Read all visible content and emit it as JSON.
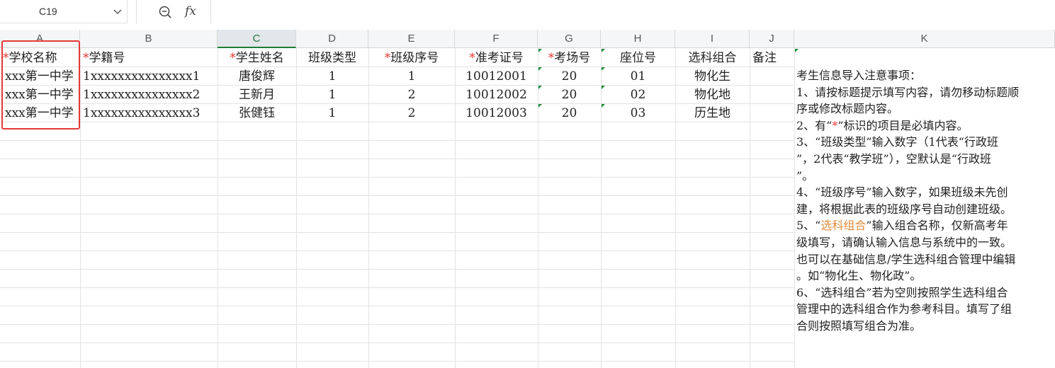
{
  "name_box": {
    "ref": "C19"
  },
  "formula_bar": {
    "fx_label": "fx",
    "content": ""
  },
  "columns": [
    "A",
    "B",
    "C",
    "D",
    "E",
    "F",
    "G",
    "H",
    "I",
    "J",
    "K"
  ],
  "headers": [
    {
      "col": "A",
      "star": "*",
      "label": "学校名称"
    },
    {
      "col": "B",
      "star": "*",
      "label": "学籍号"
    },
    {
      "col": "C",
      "star": "*",
      "label": "学生姓名"
    },
    {
      "col": "D",
      "star": "",
      "label": "班级类型"
    },
    {
      "col": "E",
      "star": "*",
      "label": "班级序号"
    },
    {
      "col": "F",
      "star": "*",
      "label": "准考证号"
    },
    {
      "col": "G",
      "star": "*",
      "label": "考场号"
    },
    {
      "col": "H",
      "star": "",
      "label": "座位号"
    },
    {
      "col": "I",
      "star": "",
      "label": "选科组合"
    },
    {
      "col": "J",
      "star": "",
      "label": "备注"
    }
  ],
  "rows": [
    [
      "xxx第一中学",
      "1xxxxxxxxxxxxxxx1",
      "唐俊辉",
      "1",
      "1",
      "10012001",
      "20",
      "01",
      "物化生",
      ""
    ],
    [
      "xxx第一中学",
      "1xxxxxxxxxxxxxxx2",
      "王新月",
      "1",
      "2",
      "10012002",
      "20",
      "02",
      "物化地",
      ""
    ],
    [
      "xxx第一中学",
      "1xxxxxxxxxxxxxxx3",
      "张健钰",
      "1",
      "2",
      "10012003",
      "20",
      "03",
      "历生地",
      ""
    ]
  ],
  "notes": {
    "title": "考生信息导入注意事项：",
    "l1": "1、请按标题提示填写内容，请勿移动标题顺",
    "l2": "序或修改标题内容。",
    "l3a": "2、有“",
    "l3star": "*",
    "l3b": "”标识的项目是必填内容。",
    "l4": "3、“班级类型”输入数字（1代表“行政班",
    "l5": "”，2代表“教学班”），空默认是“行政班",
    "l6": "”。",
    "l7": "4、“班级序号”输入数字，如果班级未先创",
    "l8": "建，将根据此表的班级序号自动创建班级。",
    "l9a": "5、“",
    "l9hl": "选科组合",
    "l9b": "”输入组合名称，仅新高考年",
    "l10": "级填写，请确认输入信息与系统中的一致。",
    "l11": "也可以在基础信息/学生选科组合管理中编辑",
    "l12": "。如“物化生、物化政”。",
    "l13": "6、“选科组合”若为空则按照学生选科组合",
    "l14": "管理中的选科组合作为参考科目。填写了组",
    "l15": "合则按照填写组合为准。"
  },
  "colors": {
    "star": "#e53935",
    "highlight": "#e08a3c",
    "selection_box": "#e53935",
    "active_col": "#217346"
  }
}
